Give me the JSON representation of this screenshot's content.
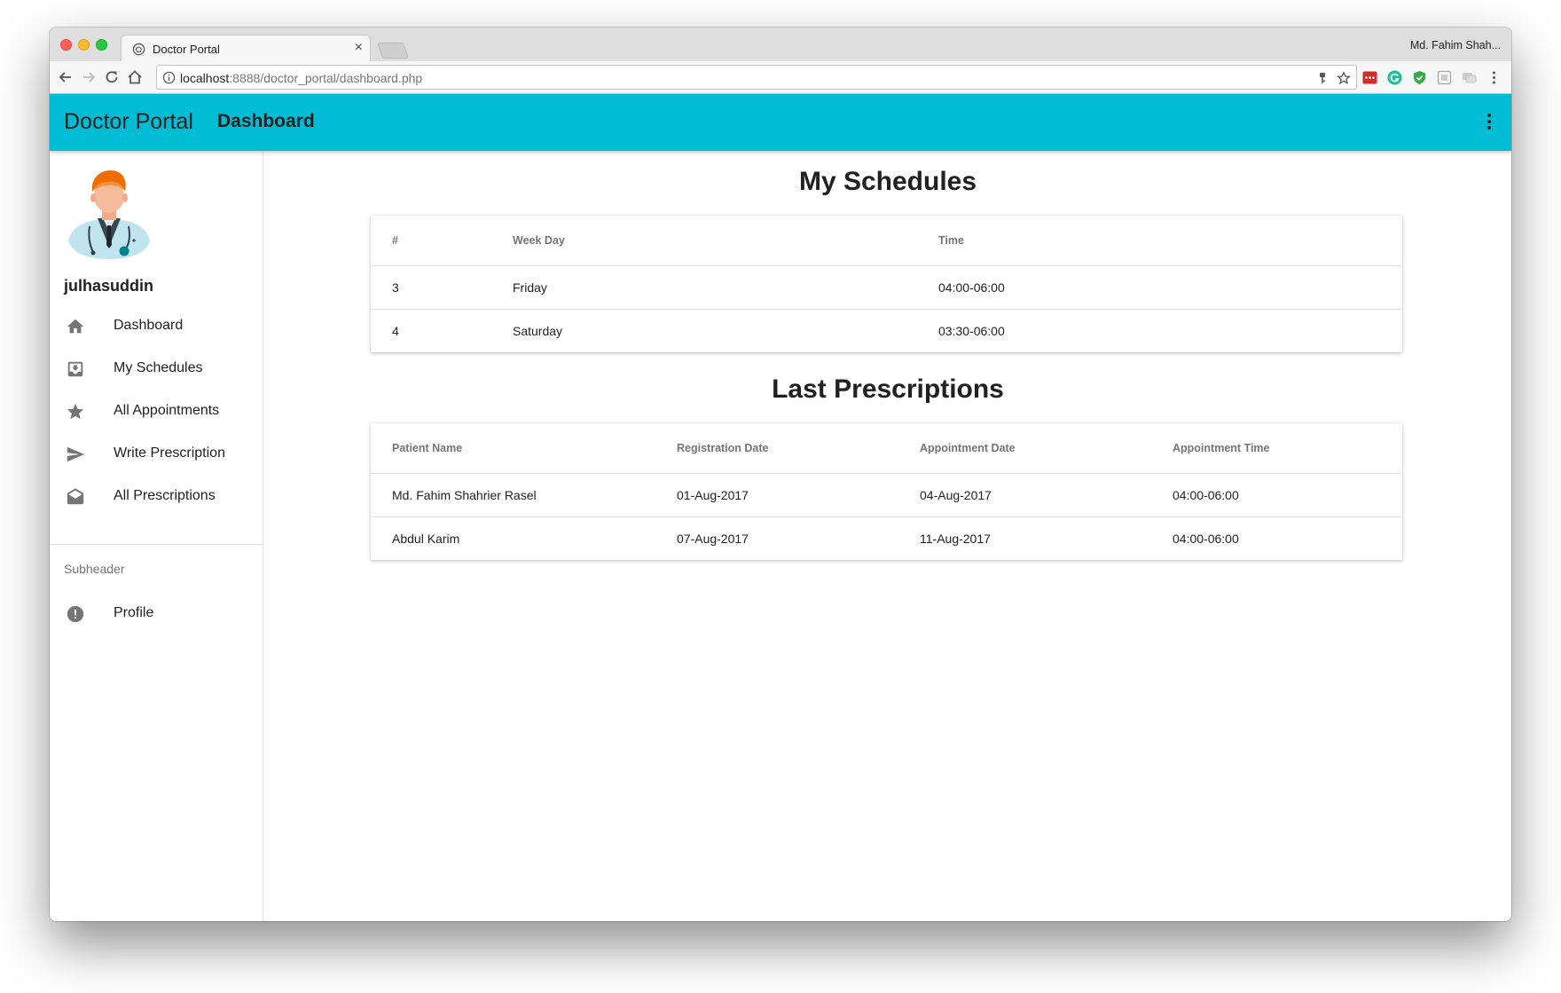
{
  "browser": {
    "tab_title": "Doctor Portal",
    "tab_close": "×",
    "profile_name": "Md. Fahim Shah...",
    "url_host": "localhost",
    "url_rest": ":8888/doctor_portal/dashboard.php"
  },
  "appbar": {
    "brand": "Doctor Portal",
    "title": "Dashboard",
    "color": "#00bcd4"
  },
  "sidebar": {
    "username": "julhasuddin",
    "items": [
      {
        "label": "Dashboard",
        "icon": "home-icon"
      },
      {
        "label": "My Schedules",
        "icon": "inbox-icon"
      },
      {
        "label": "All Appointments",
        "icon": "star-icon"
      },
      {
        "label": "Write Prescription",
        "icon": "send-icon"
      },
      {
        "label": "All Prescriptions",
        "icon": "drafts-icon"
      }
    ],
    "subheader": "Subheader",
    "profile": {
      "label": "Profile",
      "icon": "alert-circle-icon"
    }
  },
  "schedules": {
    "title": "My Schedules",
    "headers": [
      "#",
      "Week Day",
      "Time"
    ],
    "rows": [
      [
        "3",
        "Friday",
        "04:00-06:00"
      ],
      [
        "4",
        "Saturday",
        "03:30-06:00"
      ]
    ]
  },
  "prescriptions": {
    "title": "Last Prescriptions",
    "headers": [
      "Patient Name",
      "Registration Date",
      "Appointment Date",
      "Appointment Time"
    ],
    "rows": [
      [
        "Md. Fahim Shahrier Rasel",
        "01-Aug-2017",
        "04-Aug-2017",
        "04:00-06:00"
      ],
      [
        "Abdul Karim",
        "07-Aug-2017",
        "11-Aug-2017",
        "04:00-06:00"
      ]
    ]
  }
}
